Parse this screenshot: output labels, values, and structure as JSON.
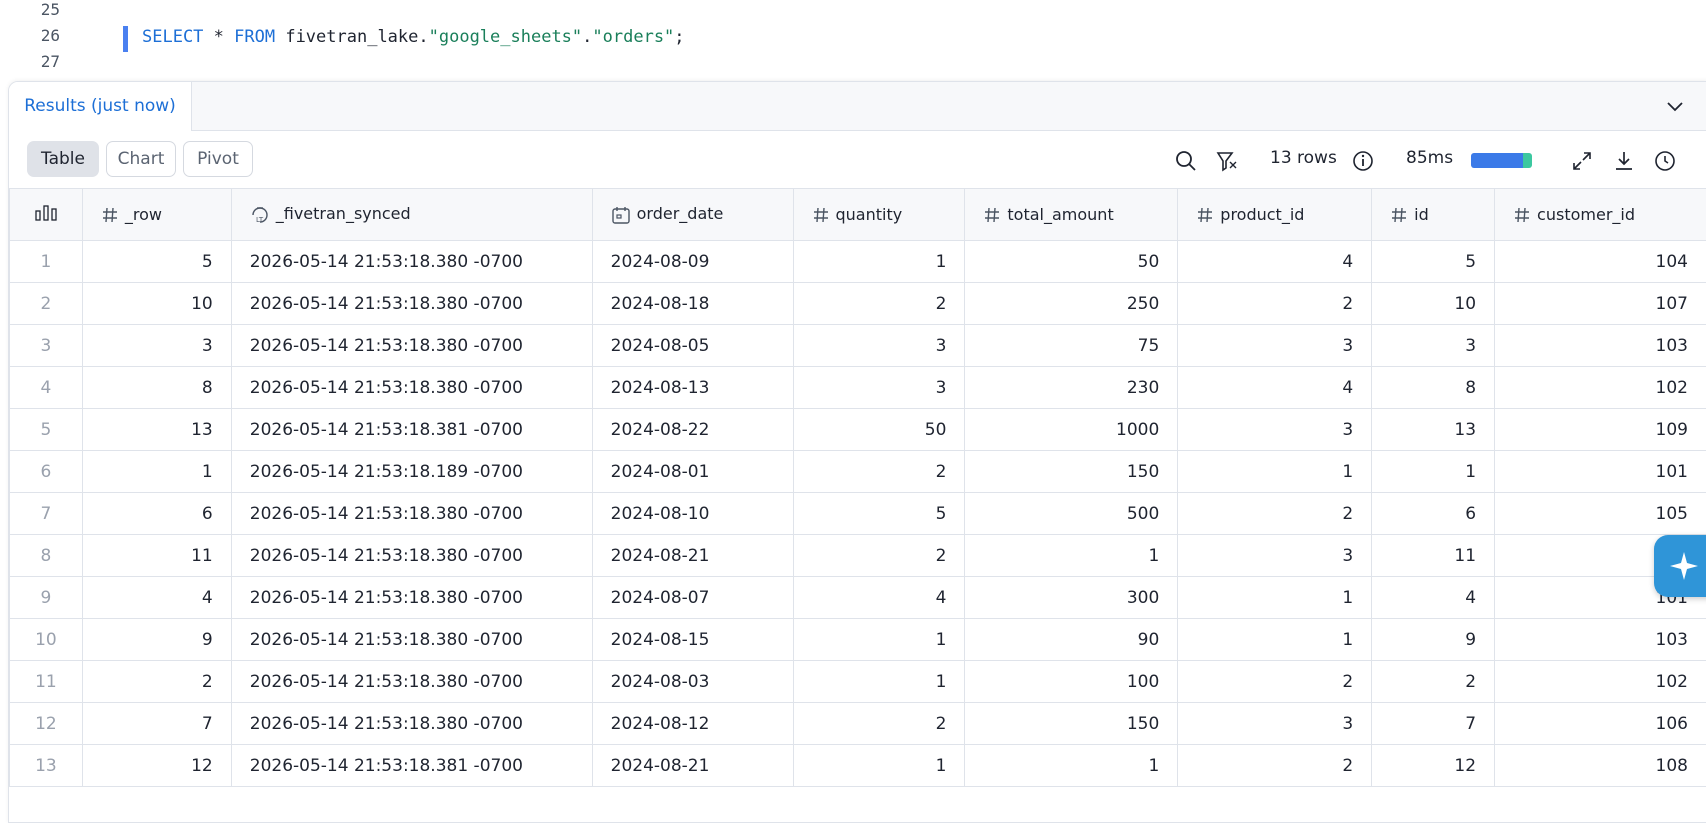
{
  "editor": {
    "lines": [
      {
        "num": "25"
      },
      {
        "num": "26"
      },
      {
        "num": "27"
      }
    ],
    "query": {
      "kw1": "SELECT",
      "star": " * ",
      "kw2": "FROM",
      "ident": " fivetran_lake.",
      "str1": "\"google_sheets\"",
      "dot": ".",
      "str2": "\"orders\"",
      "end": ";"
    }
  },
  "results": {
    "tab_label": "Results (just now)",
    "view_tabs": [
      "Table",
      "Chart",
      "Pivot"
    ],
    "active_view": "Table",
    "row_count": "13 rows",
    "duration": "85ms",
    "progress_fraction": 0.86
  },
  "columns": [
    "_row",
    "_fivetran_synced",
    "order_date",
    "quantity",
    "total_amount",
    "product_id",
    "id",
    "customer_id"
  ],
  "rows": [
    [
      "1",
      "5",
      "2026-05-14 21:53:18.380 -0700",
      "2024-08-09",
      "1",
      "50",
      "4",
      "5",
      "104"
    ],
    [
      "2",
      "10",
      "2026-05-14 21:53:18.380 -0700",
      "2024-08-18",
      "2",
      "250",
      "2",
      "10",
      "107"
    ],
    [
      "3",
      "3",
      "2026-05-14 21:53:18.380 -0700",
      "2024-08-05",
      "3",
      "75",
      "3",
      "3",
      "103"
    ],
    [
      "4",
      "8",
      "2026-05-14 21:53:18.380 -0700",
      "2024-08-13",
      "3",
      "230",
      "4",
      "8",
      "102"
    ],
    [
      "5",
      "13",
      "2026-05-14 21:53:18.381 -0700",
      "2024-08-22",
      "50",
      "1000",
      "3",
      "13",
      "109"
    ],
    [
      "6",
      "1",
      "2026-05-14 21:53:18.189 -0700",
      "2024-08-01",
      "2",
      "150",
      "1",
      "1",
      "101"
    ],
    [
      "7",
      "6",
      "2026-05-14 21:53:18.380 -0700",
      "2024-08-10",
      "5",
      "500",
      "2",
      "6",
      "105"
    ],
    [
      "8",
      "11",
      "2026-05-14 21:53:18.380 -0700",
      "2024-08-21",
      "2",
      "1",
      "3",
      "11",
      "1"
    ],
    [
      "9",
      "4",
      "2026-05-14 21:53:18.380 -0700",
      "2024-08-07",
      "4",
      "300",
      "1",
      "4",
      "101"
    ],
    [
      "10",
      "9",
      "2026-05-14 21:53:18.380 -0700",
      "2024-08-15",
      "1",
      "90",
      "1",
      "9",
      "103"
    ],
    [
      "11",
      "2",
      "2026-05-14 21:53:18.380 -0700",
      "2024-08-03",
      "1",
      "100",
      "2",
      "2",
      "102"
    ],
    [
      "12",
      "7",
      "2026-05-14 21:53:18.380 -0700",
      "2024-08-12",
      "2",
      "150",
      "3",
      "7",
      "106"
    ],
    [
      "13",
      "12",
      "2026-05-14 21:53:18.381 -0700",
      "2024-08-21",
      "1",
      "1",
      "2",
      "12",
      "108"
    ]
  ],
  "colors": {
    "accent": "#1d6fd6",
    "string": "#1a7f5a",
    "fab": "#2f95d8"
  }
}
